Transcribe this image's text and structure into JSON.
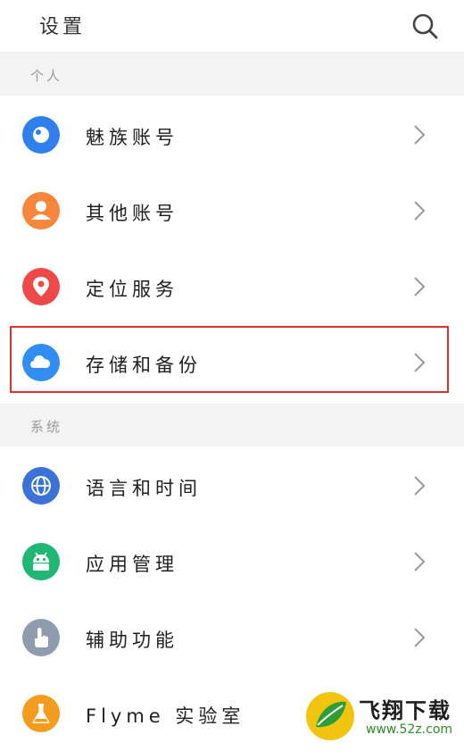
{
  "header": {
    "title": "设置",
    "search_icon": "search-icon"
  },
  "sections": [
    {
      "title": "个人"
    },
    {
      "title": "系统"
    }
  ],
  "personal_items": [
    {
      "label": "魅族账号",
      "icon": "meizu-account-icon",
      "color": "#2f80ed"
    },
    {
      "label": "其他账号",
      "icon": "person-icon",
      "color": "#f5863c"
    },
    {
      "label": "定位服务",
      "icon": "location-pin-icon",
      "color": "#ee4848"
    },
    {
      "label": "存储和备份",
      "icon": "cloud-icon",
      "color": "#2f8ef0"
    }
  ],
  "system_items": [
    {
      "label": "语言和时间",
      "icon": "globe-icon",
      "color": "#3b72d8"
    },
    {
      "label": "应用管理",
      "icon": "android-icon",
      "color": "#1fb773"
    },
    {
      "label": "辅助功能",
      "icon": "hand-pointer-icon",
      "color": "#8f9cae"
    },
    {
      "label": "Flyme 实验室",
      "icon": "flask-icon",
      "color": "#f39c1e"
    }
  ],
  "watermark": {
    "name": "飞翔下载",
    "url": "www.52z.com"
  }
}
